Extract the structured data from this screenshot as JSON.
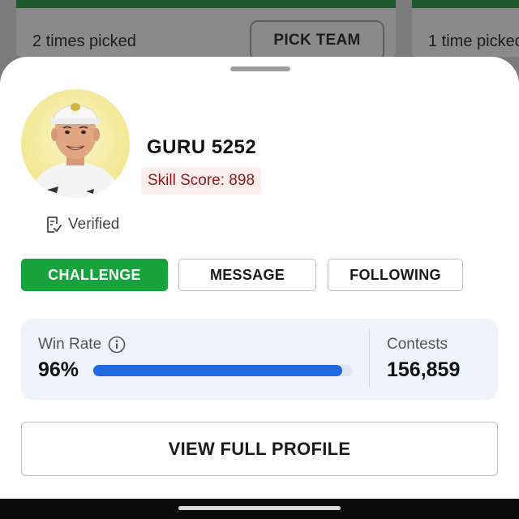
{
  "background": {
    "left_card": {
      "picked_text": "2 times picked",
      "pick_button_label": "PICK TEAM"
    },
    "right_card": {
      "picked_text": "1 time picked"
    }
  },
  "profile": {
    "name": "GURU 5252",
    "skill_score": "Skill Score: 898",
    "verified_label": "Verified",
    "avatar_icon": "user-photo"
  },
  "actions": {
    "challenge": "CHALLENGE",
    "message": "MESSAGE",
    "following": "FOLLOWING"
  },
  "stats": {
    "win_rate_label": "Win Rate",
    "win_rate_value": "96%",
    "win_rate_fraction": 0.96,
    "contests_label": "Contests",
    "contests_value": "156,859"
  },
  "view_profile_label": "VIEW FULL PROFILE",
  "colors": {
    "challenge_green": "#17a33b",
    "progress_blue": "#2169e0",
    "skill_text": "#8b1a1a",
    "skill_bg": "#fdeeee",
    "stats_bg": "#eef4fc"
  }
}
